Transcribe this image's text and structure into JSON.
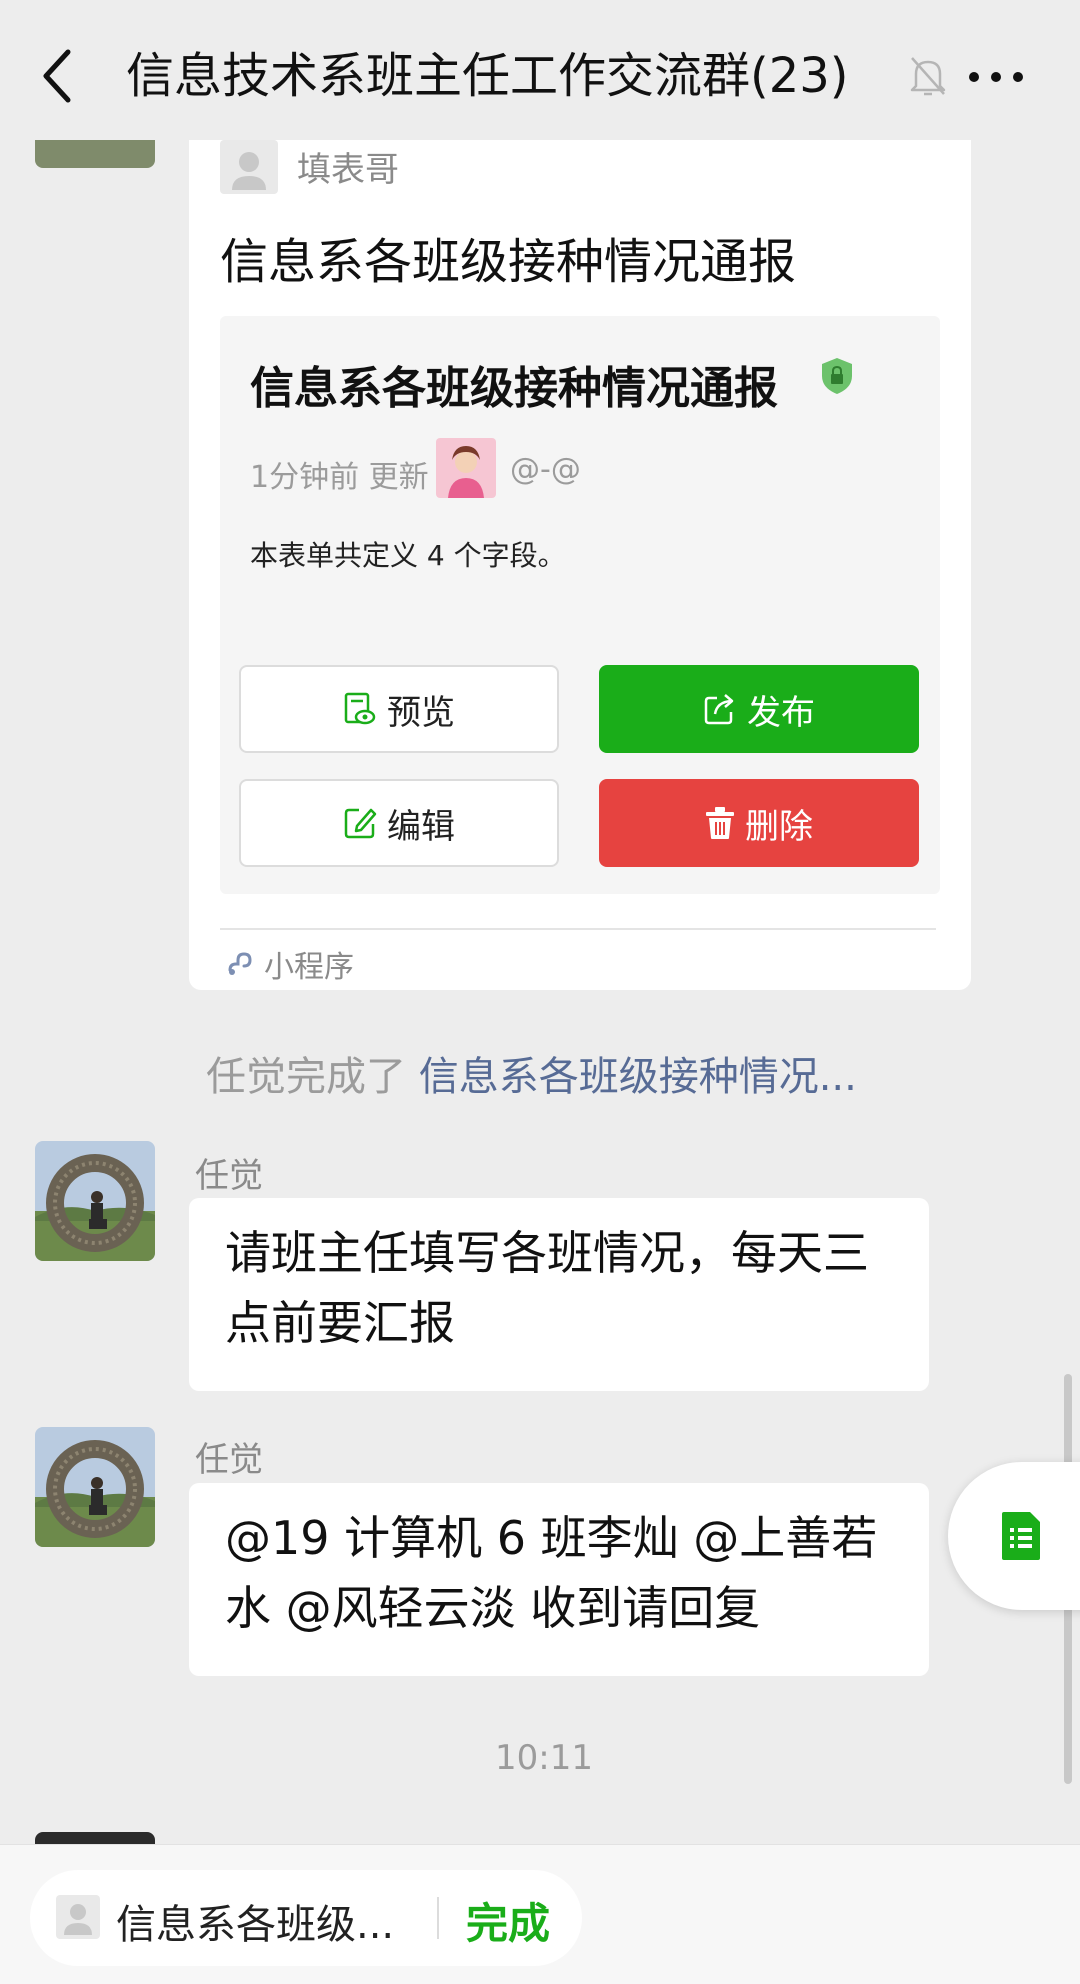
{
  "header": {
    "title": "信息技术系班主任工作交流群(23)",
    "back_icon": "chevron-left-icon",
    "mute_icon": "bell-off-icon",
    "more_icon": "ellipsis-icon"
  },
  "card": {
    "owner": "填表哥",
    "title": "信息系各班级接种情况通报",
    "inner_title": "信息系各班级接种情况通报",
    "meta_time": "1分钟前 更新",
    "meta_user": "@-@",
    "description": "本表单共定义 4 个字段。",
    "buttons": {
      "preview": "预览",
      "publish": "发布",
      "edit": "编辑",
      "delete": "删除"
    },
    "footer_label": "小程序"
  },
  "system_message": {
    "prefix": "任觉完成了",
    "link": "信息系各班级接种情况..."
  },
  "messages": [
    {
      "sender": "任觉",
      "text": "请班主任填写各班情况，每天三点前要汇报"
    },
    {
      "sender": "任觉",
      "text": "@19 计算机 6 班李灿  @上善若水  @风轻云淡  收到请回复"
    }
  ],
  "timestamp": "10:11",
  "bottom_bar": {
    "form_name": "信息系各班级...",
    "done_label": "完成"
  },
  "colors": {
    "primary_green": "#1aad19",
    "danger_red": "#e64340",
    "link_blue": "#576b95",
    "background": "#ededed"
  }
}
